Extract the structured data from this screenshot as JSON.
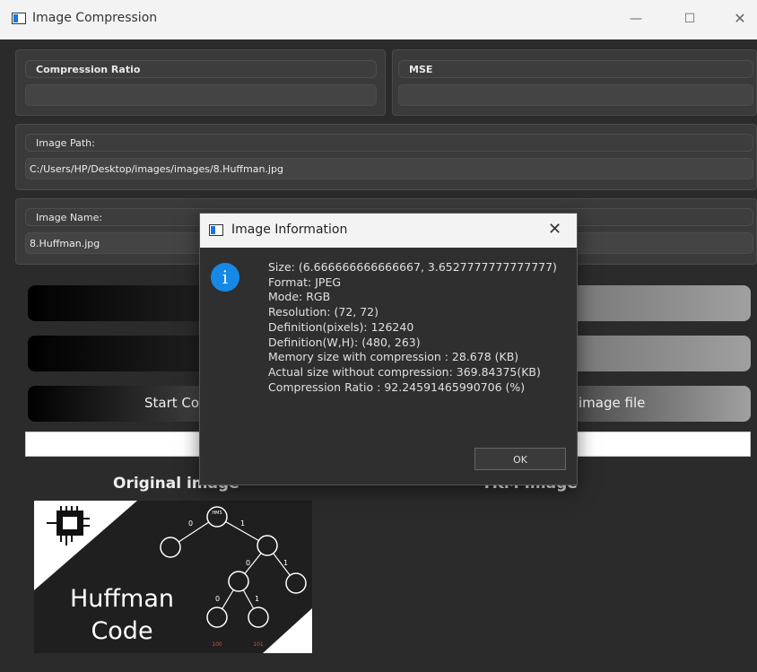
{
  "window": {
    "title": "Image Compression",
    "minimize": "—",
    "maximize": "☐",
    "close": "✕"
  },
  "metrics": {
    "compression_ratio_label": "Compression Ratio",
    "compression_ratio_value": "",
    "mse_label": "MSE",
    "mse_value": ""
  },
  "image_path": {
    "label": "Image Path:",
    "value": "C:/Users/HP/Desktop/images/images/8.Huffman.jpg"
  },
  "image_name": {
    "label": "Image Name:",
    "value": "8.Huffman.jpg"
  },
  "buttons": {
    "start_compression": "Start Co",
    "save_file": "image file"
  },
  "captions": {
    "original": "Original image",
    "result": "TKM Image"
  },
  "original_image": {
    "line1": "Huffman",
    "line2": "Code",
    "node_root": "HMS",
    "edge_0a": "0",
    "edge_1a": "1",
    "edge_0b": "0",
    "edge_1b": "1",
    "edge_0c": "0",
    "edge_1c": "1",
    "leaf_100": "100",
    "leaf_101": "101"
  },
  "dialog": {
    "title": "Image Information",
    "close": "✕",
    "info_symbol": "i",
    "lines": [
      "Size: (6.666666666666667, 3.6527777777777777)",
      "Format: JPEG",
      "Mode: RGB",
      "Resolution: (72, 72)",
      "Definition(pixels): 126240",
      "Definition(W,H): (480, 263)",
      "Memory size with compression : 28.678 (KB)",
      "Actual size without compression: 369.84375(KB)",
      "Compression Ratio : 92.24591465990706 (%)"
    ],
    "ok": "OK"
  },
  "colors": {
    "accent": "#1689e6",
    "background": "#2b2b2b",
    "panel": "#3a3a3a"
  }
}
